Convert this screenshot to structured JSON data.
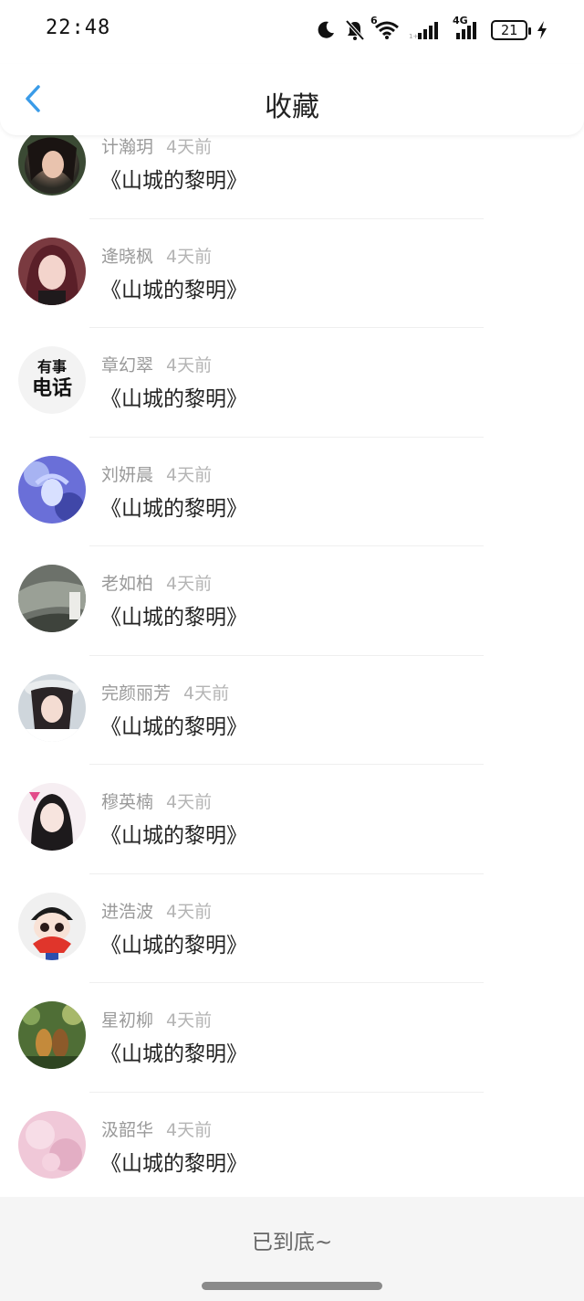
{
  "status": {
    "time": "22:48",
    "battery": "21",
    "icons": [
      "moon-icon",
      "bell-off-icon",
      "wifi-icon",
      "signal-icon",
      "signal-4g-icon",
      "battery-icon",
      "charging-icon"
    ],
    "signal_label": "4G",
    "wifi_label": "6"
  },
  "header": {
    "title": "收藏",
    "back_icon": "chevron-left-icon",
    "accent": "#3a9be8"
  },
  "items": [
    {
      "name": "计瀚玥",
      "time": "4天前",
      "book": "《山城的黎明》"
    },
    {
      "name": "逄晓枫",
      "time": "4天前",
      "book": "《山城的黎明》"
    },
    {
      "name": "章幻翠",
      "time": "4天前",
      "book": "《山城的黎明》",
      "avatar_line1": "有事",
      "avatar_line2": "电话"
    },
    {
      "name": "刘妍晨",
      "time": "4天前",
      "book": "《山城的黎明》"
    },
    {
      "name": "老如柏",
      "time": "4天前",
      "book": "《山城的黎明》"
    },
    {
      "name": "完颜丽芳",
      "time": "4天前",
      "book": "《山城的黎明》"
    },
    {
      "name": "穆英楠",
      "time": "4天前",
      "book": "《山城的黎明》"
    },
    {
      "name": "进浩波",
      "time": "4天前",
      "book": "《山城的黎明》"
    },
    {
      "name": "星初柳",
      "time": "4天前",
      "book": "《山城的黎明》"
    },
    {
      "name": "汲韶华",
      "time": "4天前",
      "book": "《山城的黎明》"
    }
  ],
  "footer": {
    "text": "已到底~"
  }
}
